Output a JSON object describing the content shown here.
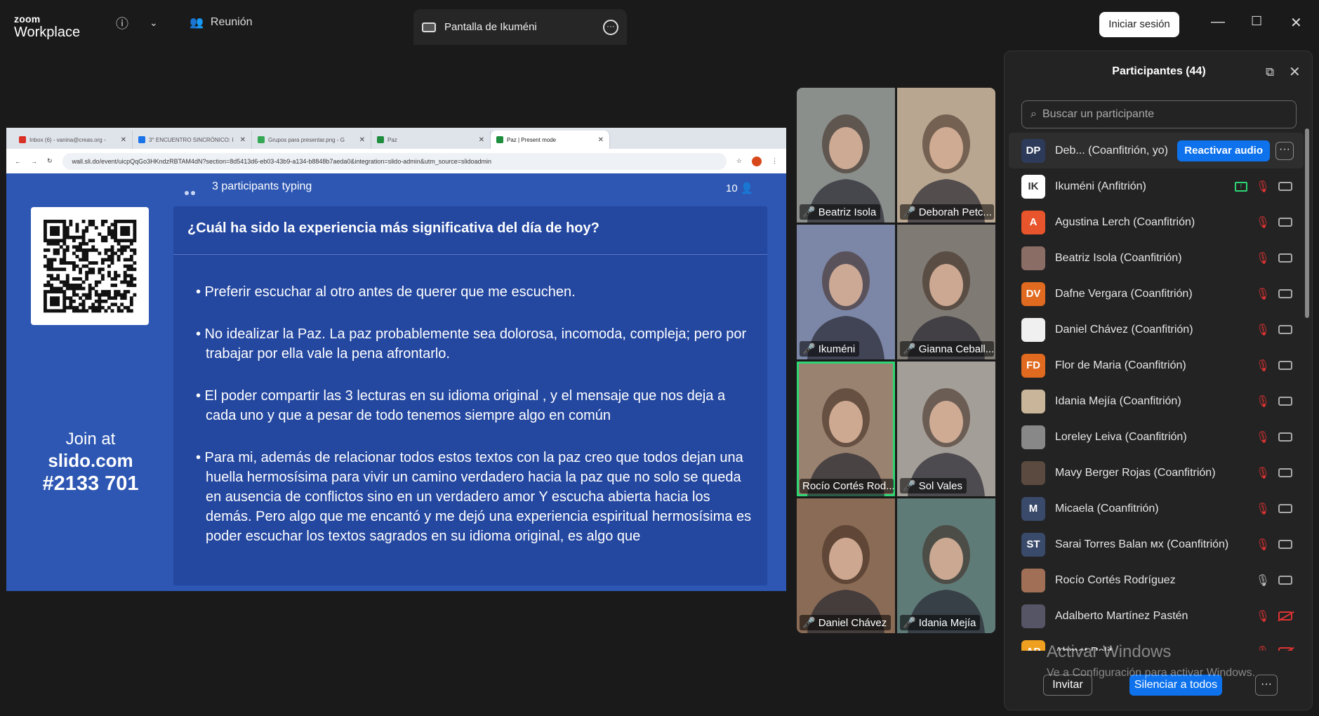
{
  "topbar": {
    "logo_line1": "zoom",
    "logo_line2": "Workplace",
    "meeting_label": "Reunión",
    "share_tab_label": "Pantalla de Ikuméni",
    "signin_label": "Iniciar sesión"
  },
  "browser": {
    "tabs": [
      {
        "label": "Inbox (6) - vanina@creas.org -",
        "color": "#d93025"
      },
      {
        "label": "3° ENCUENTRO SINCRÓNICO: I",
        "color": "#1a73e8"
      },
      {
        "label": "Grupos para presentar.png - G",
        "color": "#34a853"
      },
      {
        "label": "Paz",
        "color": "#1e8e3e"
      },
      {
        "label": "Paz | Present mode",
        "color": "#1e8e3e"
      }
    ],
    "url": "wall.sli.do/event/uicpQqGo3HKndzRBTAM4dN?section=8d5413d6-eb03-43b9-a134-b8848b7aeda0&integration=slido-admin&utm_source=slidoadmin"
  },
  "slido": {
    "typing_text": "3 participants typing",
    "participant_count": "10",
    "join_line1": "Join at",
    "join_line2": "slido.com",
    "join_line3": "#2133 701",
    "question": "¿Cuál ha sido la experiencia más significativa del día de hoy?",
    "answers": [
      "• Preferir escuchar al otro antes de querer que me escuchen.",
      "• No idealizar la Paz. La paz probablemente sea dolorosa, incomoda, compleja; pero por trabajar por ella vale la pena afrontarlo.",
      "• El poder compartir las 3 lecturas en su idioma original , y el mensaje que nos deja a cada uno y que a pesar de todo tenemos siempre algo en común",
      "• Para mi, además de relacionar todos estos textos con la paz creo que todos dejan una huella hermosísima para vivir un camino verdadero hacia la paz que no solo se queda en ausencia de conflictos sino en un verdadero amor Y escucha abierta hacia los demás. Pero algo que me encantó y me dejó una experiencia espiritual hermosísima es poder escuchar los textos sagrados en su idioma original, es algo que"
    ]
  },
  "gallery": [
    {
      "name": "Beatriz Isola",
      "bg": "#8a8f8c",
      "muted": true
    },
    {
      "name": "Deborah Petc...",
      "bg": "#b9a690",
      "muted": true
    },
    {
      "name": "Ikuméni",
      "bg": "#7c86a6",
      "muted": true
    },
    {
      "name": "Gianna Ceball...",
      "bg": "#7f7a74",
      "muted": true
    },
    {
      "name": "Rocío Cortés Rod...",
      "bg": "#9a8270",
      "muted": false
    },
    {
      "name": "Sol Vales",
      "bg": "#a49e98",
      "muted": true
    },
    {
      "name": "Daniel Chávez",
      "bg": "#8a6b55",
      "muted": true
    },
    {
      "name": "Idania Mejía",
      "bg": "#5f7b78",
      "muted": true
    }
  ],
  "participants_panel": {
    "title": "Participantes (44)",
    "search_placeholder": "Buscar un participante",
    "reactivar_label": "Reactivar audio",
    "invite_label": "Invitar",
    "mute_all_label": "Silenciar a todos",
    "rows": [
      {
        "initials": "DP",
        "name": "Deb...   (Coanfitrión, yo)",
        "avatar_color": "#2d3a5a",
        "me": true
      },
      {
        "initials": "IK",
        "name": "Ikuméni (Anfitrión)",
        "avatar_color": "#ffffff"
      },
      {
        "initials": "A",
        "name": "Agustina Lerch (Coanfitrión)",
        "avatar_color": "#e8542b"
      },
      {
        "initials": "",
        "name": "Beatriz Isola (Coanfitrión)",
        "avatar_color": "#8a6e66"
      },
      {
        "initials": "DV",
        "name": "Dafne Vergara  (Coanfitrión)",
        "avatar_color": "#e06a1f"
      },
      {
        "initials": "",
        "name": "Daniel Chávez (Coanfitrión)",
        "avatar_color": "#f0f0f0"
      },
      {
        "initials": "FD",
        "name": "Flor de Maria (Coanfitrión)",
        "avatar_color": "#e06a1f"
      },
      {
        "initials": "",
        "name": "Idania Mejía (Coanfitrión)",
        "avatar_color": "#c9b59a"
      },
      {
        "initials": "",
        "name": "Loreley Leiva (Coanfitrión)",
        "avatar_color": "#888"
      },
      {
        "initials": "",
        "name": "Mavy Berger Rojas (Coanfitrión)",
        "avatar_color": "#5a4a3f"
      },
      {
        "initials": "M",
        "name": "Micaela (Coanfitrión)",
        "avatar_color": "#3a4a6a"
      },
      {
        "initials": "ST",
        "name": "Sarai Torres Balan ᴍx (Coanfitrión)",
        "avatar_color": "#3a4a6a"
      },
      {
        "initials": "",
        "name": "Rocío Cortés Rodríguez",
        "avatar_color": "#a06f55"
      },
      {
        "initials": "",
        "name": "Adalberto Martínez Pastén",
        "avatar_color": "#556"
      },
      {
        "initials": "AP",
        "name": "Ahmet Pelit",
        "avatar_color": "#f0a020"
      }
    ]
  },
  "watermark": {
    "line1": "Activar Windows",
    "line2": "Ve a Configuración para activar Windows."
  }
}
